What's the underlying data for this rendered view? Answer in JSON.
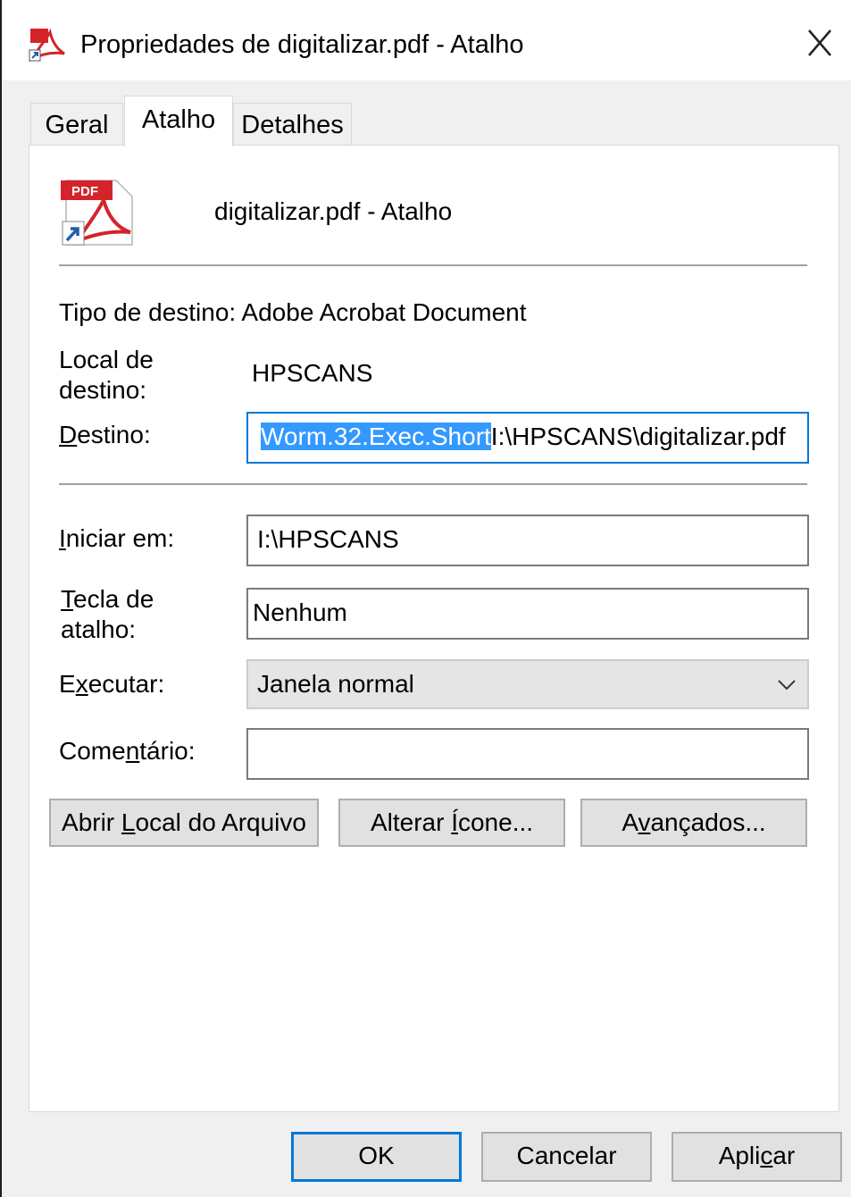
{
  "window": {
    "title": "Propriedades de digitalizar.pdf - Atalho",
    "icon": "pdf-shortcut-icon"
  },
  "tabs": [
    {
      "label": "Geral",
      "active": false
    },
    {
      "label": "Atalho",
      "active": true
    },
    {
      "label": "Detalhes",
      "active": false
    }
  ],
  "header": {
    "shortcut_name": "digitalizar.pdf - Atalho",
    "icon": "pdf-file-icon",
    "icon_badge": "PDF"
  },
  "target_type": {
    "label": "Tipo de destino: Adobe Acrobat Document"
  },
  "target_location": {
    "label_line1": "Local de",
    "label_line2": "destino:",
    "value": "HPSCANS"
  },
  "target": {
    "label_first": "D",
    "label_rest": "estino:",
    "value_selected": "Worm.32.Exec.Short",
    "value_rest": "I:\\HPSCANS\\digitalizar.pdf"
  },
  "start_in": {
    "label_first": "I",
    "label_rest": "niciar em:",
    "value": "I:\\HPSCANS"
  },
  "shortcut_key": {
    "label_first": "T",
    "label_rest": "ecla de",
    "label_line2": "atalho:",
    "value": "Nenhum"
  },
  "run": {
    "label_pre": "E",
    "label_u": "x",
    "label_post": "ecutar:",
    "value": "Janela normal"
  },
  "comment": {
    "label_pre": "Come",
    "label_u": "n",
    "label_post": "tário:",
    "value": ""
  },
  "action_buttons": {
    "open_location_pre": "Abrir ",
    "open_location_u": "L",
    "open_location_post": "ocal do Arquivo",
    "change_icon_pre": "Alterar ",
    "change_icon_u": "Í",
    "change_icon_post": "cone...",
    "advanced_pre": "A",
    "advanced_u": "v",
    "advanced_post": "ançados..."
  },
  "footer_buttons": {
    "ok": "OK",
    "cancel": "Cancelar",
    "apply_pre": "Apli",
    "apply_u": "c",
    "apply_post": "ar"
  },
  "colors": {
    "selection": "#3399ff",
    "focus_border": "#0078d7",
    "pdf_red": "#d4242a"
  }
}
